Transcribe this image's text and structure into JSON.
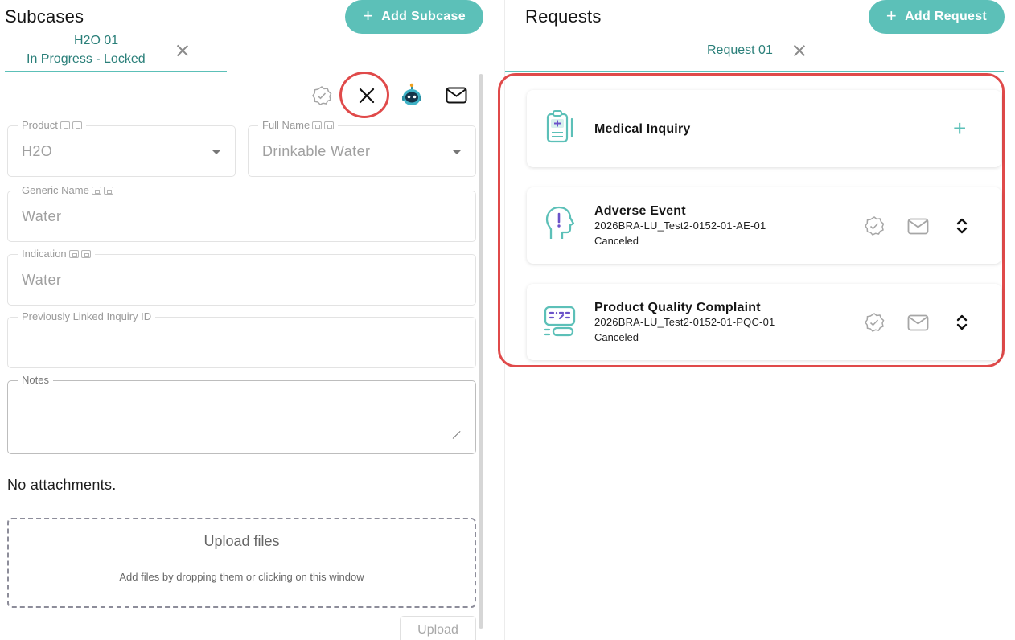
{
  "subcases": {
    "title": "Subcases",
    "add_button": "Add Subcase",
    "tab": {
      "name": "H2O 01",
      "status": "In Progress - Locked"
    },
    "fields": {
      "product": {
        "label": "Product",
        "value": "H2O"
      },
      "full_name": {
        "label": "Full Name",
        "value": "Drinkable Water"
      },
      "generic_name": {
        "label": "Generic Name",
        "value": "Water"
      },
      "indication": {
        "label": "Indication",
        "value": "Water"
      },
      "prev_linked": {
        "label": "Previously Linked Inquiry ID",
        "value": ""
      },
      "notes": {
        "label": "Notes",
        "value": ""
      }
    },
    "attachments_text": "No attachments.",
    "upload_zone": {
      "title": "Upload files",
      "hint": "Add files by dropping them or clicking on this window"
    },
    "upload_button": "Upload"
  },
  "requests": {
    "title": "Requests",
    "add_button": "Add Request",
    "tab": "Request 01",
    "cards": [
      {
        "title": "Medical Inquiry",
        "code": "",
        "status": "",
        "icon": "clipboard-plus-icon"
      },
      {
        "title": "Adverse Event",
        "code": "2026BRA-LU_Test2-0152-01-AE-01",
        "status": "Canceled",
        "icon": "head-exclamation-icon"
      },
      {
        "title": "Product Quality Complaint",
        "code": "2026BRA-LU_Test2-0152-01-PQC-01",
        "status": "Canceled",
        "icon": "medicine-pack-icon"
      }
    ]
  },
  "colors": {
    "accent": "#5cc0b8",
    "highlight": "#e04a4a"
  }
}
